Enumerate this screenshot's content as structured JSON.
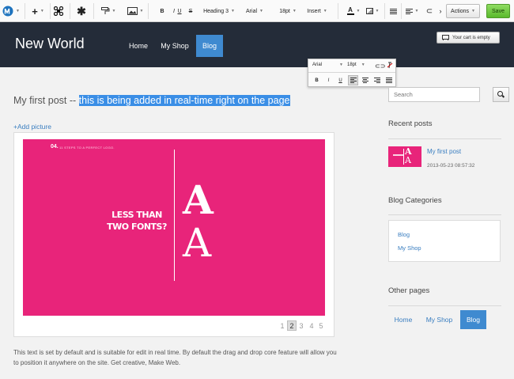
{
  "toolbar": {
    "font_style": "Heading 3",
    "font_family": "Arial",
    "font_size": "18pt",
    "insert": "Insert",
    "actions": "Actions",
    "save": "Save",
    "bold": "B",
    "italic": "I",
    "underline": "U",
    "strike": "S"
  },
  "site": {
    "logo": "New World",
    "nav": [
      "Home",
      "My Shop",
      "Blog"
    ],
    "active_nav": "Blog",
    "cart": "Your cart is empty"
  },
  "mini_toolbar": {
    "font_family": "Arial",
    "font_size": "18pt",
    "bold": "B",
    "italic": "I",
    "underline": "U"
  },
  "post": {
    "title_plain": "My first post -- ",
    "title_selected": "this is being added in real-time right on the page",
    "add_picture": "+Add picture",
    "body": "This text is set by default and is suitable for edit in real time. By default the drag and drop core feature will allow you to position it anywhere on the site. Get creative, Make Web."
  },
  "slide": {
    "number": "04.",
    "subtitle": "11 STEPS TO A PERFECT LOGO.",
    "headline": "LESS THAN TWO FONTS?",
    "letter_bold": "A",
    "letter_thin": "A",
    "background": "#e8247a"
  },
  "pager": [
    "1",
    "2",
    "3",
    "4",
    "5"
  ],
  "pager_active": "2",
  "sidebar": {
    "search_placeholder": "Search",
    "recent_heading": "Recent posts",
    "recent_post_title": "My first post",
    "recent_post_date": "2013-05-23 08:57:32",
    "categories_heading": "Blog Categories",
    "categories": [
      "Blog",
      "My Shop"
    ],
    "other_heading": "Other pages",
    "other_pages": [
      "Home",
      "My Shop",
      "Blog"
    ]
  },
  "colors": {
    "header_bg": "#242c39",
    "accent": "#3f8ad0",
    "link": "#3a7ec0",
    "selection": "#3a8ee6",
    "save": "#59b92c"
  }
}
